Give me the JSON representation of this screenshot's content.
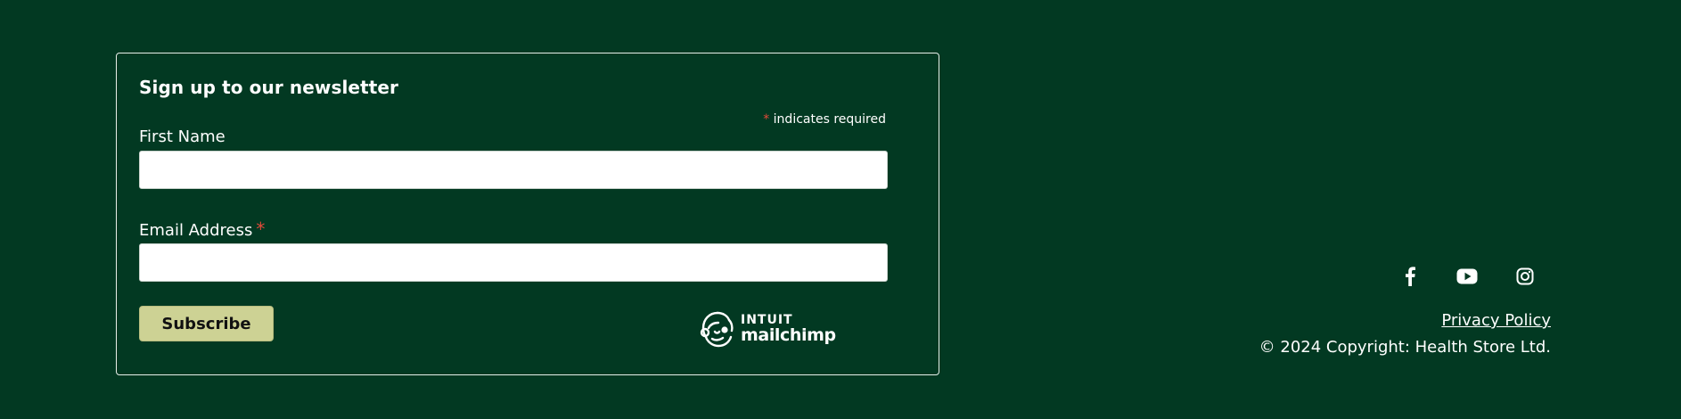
{
  "newsletter": {
    "title": "Sign up to our newsletter",
    "required_asterisk": "*",
    "required_note": "indicates required",
    "first_name_label": "First Name",
    "first_name_value": "",
    "email_label": "Email Address",
    "email_value": "",
    "subscribe_label": "Subscribe",
    "logo_intuit": "INTUIT",
    "logo_mailchimp": "mailchimp"
  },
  "social": {
    "icons": [
      "facebook-icon",
      "youtube-icon",
      "instagram-icon"
    ]
  },
  "footer": {
    "privacy_label": "Privacy Policy",
    "copyright": "© 2024 Copyright: Health Store Ltd."
  },
  "colors": {
    "background": "#023922",
    "accent_button": "#cdd294",
    "required": "#e24a39"
  }
}
